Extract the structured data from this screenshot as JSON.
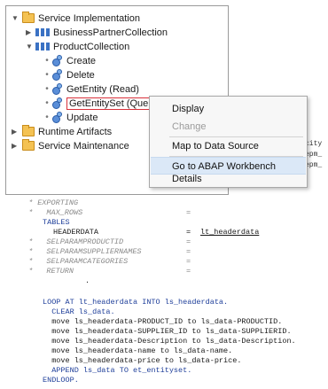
{
  "tree": {
    "service_implementation": "Service Implementation",
    "business_partner_collection": "BusinessPartnerCollection",
    "product_collection": "ProductCollection",
    "operations": [
      "Create",
      "Delete",
      "GetEntity (Read)",
      "GetEntitySet (Query)",
      "Update"
    ],
    "runtime_artifacts": "Runtime Artifacts",
    "service_maintenance": "Service Maintenance"
  },
  "context_menu": {
    "items": [
      "Display",
      "Change",
      "Map to Data Source",
      "Go to ABAP Workbench",
      "Details"
    ],
    "disabled": [
      "Change"
    ],
    "highlighted": "Go to ABAP Workbench"
  },
  "side_code": [
    "city",
    "epm_",
    "epm_"
  ],
  "code": {
    "exporting": "* EXPORTING",
    "max_rows": "*   MAX_ROWS",
    "tables": "TABLES",
    "headerdata": "HEADERDATA",
    "headerdata_value": "lt_headerdata",
    "selparamproductid": "*   SELPARAMPRODUCTID",
    "selparamsuppliernames": "*   SELPARAMSUPPLIERNAMES",
    "selparamcategories": "*   SELPARAMCATEGORIES",
    "return": "*   RETURN",
    "equals": "=",
    "dot": ".",
    "loop": "LOOP AT lt_headerdata INTO ls_headerdata.",
    "clear": "  CLEAR ls_data.",
    "move1": "  move ls_headerdata-PRODUCT_ID to ls_data-PRODUCTID.",
    "move2": "  move ls_headerdata-SUPPLIER_ID to ls_data-SUPPLIERID.",
    "move3": "  move ls_headerdata-Description to ls_data-Description.",
    "move4": "  move ls_headerdata-name to ls_data-name.",
    "move5": "  move ls_headerdata-price to ls_data-price.",
    "append": "  APPEND ls_data TO et_entityset.",
    "endloop": "ENDLOOP."
  }
}
